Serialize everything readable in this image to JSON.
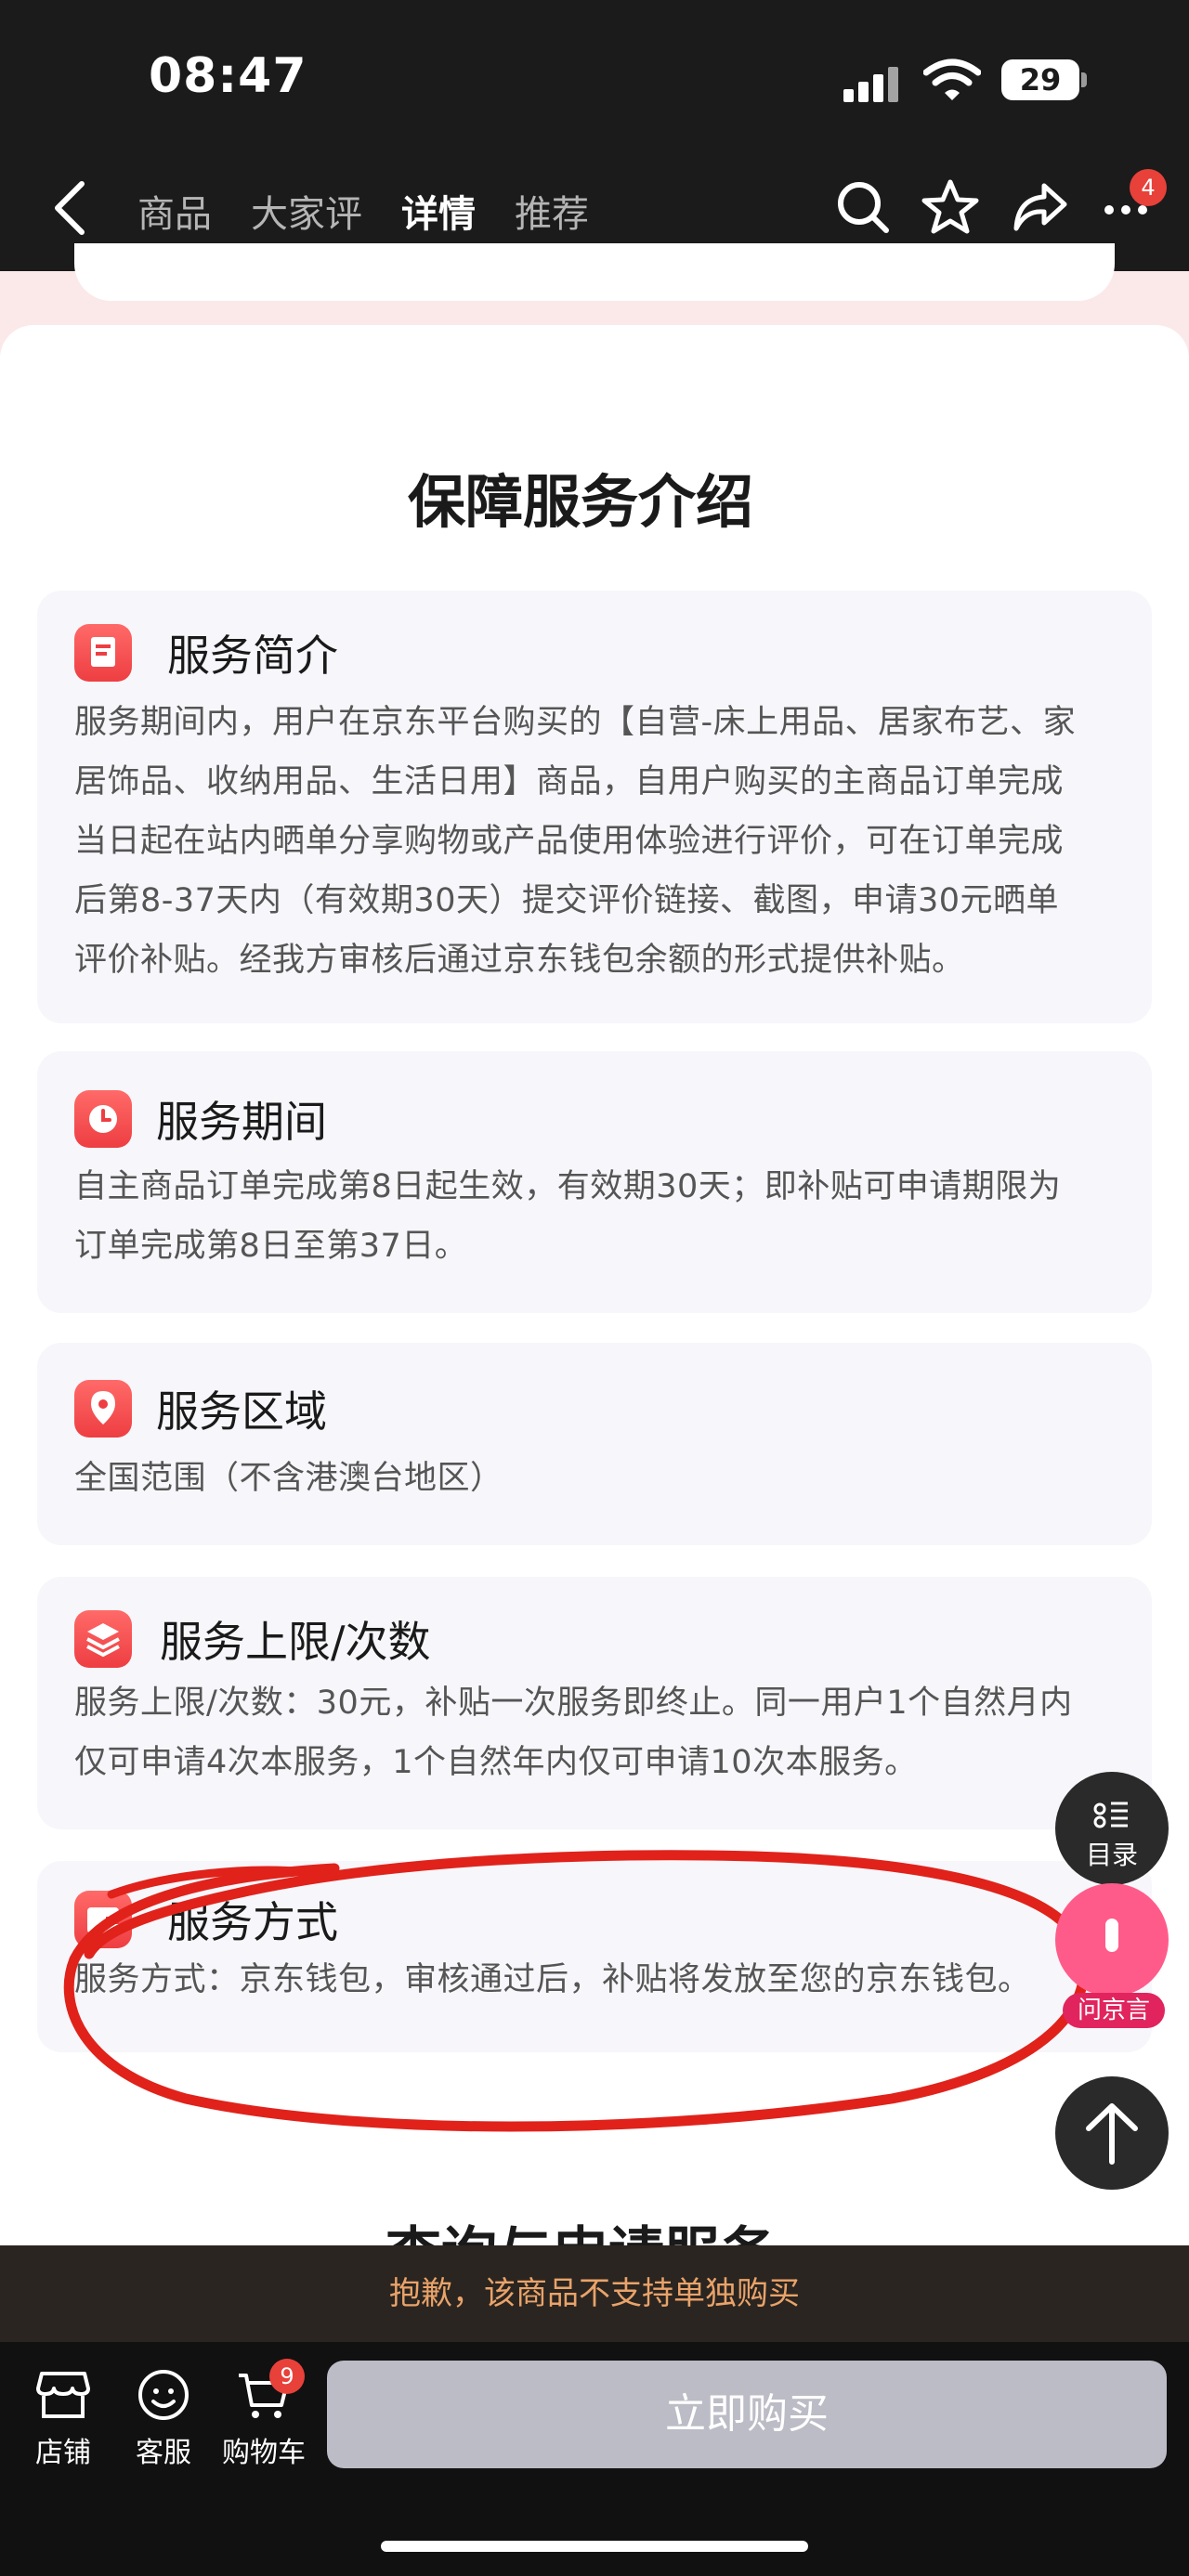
{
  "status_bar": {
    "time": "08:47",
    "battery": "29"
  },
  "nav": {
    "tabs": [
      {
        "label": "商品",
        "active": false
      },
      {
        "label": "大家评",
        "active": false
      },
      {
        "label": "详情",
        "active": true
      },
      {
        "label": "推荐",
        "active": false
      }
    ],
    "icons": [
      "back-icon",
      "search-icon",
      "star-icon",
      "share-icon",
      "more-icon"
    ],
    "more_badge": "4"
  },
  "panel": {
    "title": "保障服务介绍",
    "cards": [
      {
        "icon": "document-icon",
        "title": "服务简介",
        "lines": [
          "服务期间内，用户在京东平台购买的【自营-床上用品、居家布艺、家",
          "居饰品、收纳用品、生活日用】商品，自用户购买的主商品订单完成",
          "当日起在站内晒单分享购物或产品使用体验进行评价，可在订单完成",
          "后第8-37天内（有效期30天）提交评价链接、截图，申请30元晒单",
          "评价补贴。经我方审核后通过京东钱包余额的形式提供补贴。"
        ]
      },
      {
        "icon": "clock-icon",
        "title": "服务期间",
        "lines": [
          "自主商品订单完成第8日起生效，有效期30天；即补贴可申请期限为",
          "订单完成第8日至第37日。"
        ]
      },
      {
        "icon": "location-icon",
        "title": "服务区域",
        "lines": [
          "全国范围（不含港澳台地区）"
        ]
      },
      {
        "icon": "layers-icon",
        "title": "服务上限/次数",
        "lines": [
          "服务上限/次数：30元，补贴一次服务即终止。同一用户1个自然月内",
          "仅可申请4次本服务，1个自然年内仅可申请10次本服务。"
        ]
      },
      {
        "icon": "wallet-icon",
        "title": "服务方式",
        "lines": [
          "服务方式：京东钱包，审核通过后，补贴将发放至您的京东钱包。"
        ]
      }
    ],
    "next_section_title": "查询与申请服务"
  },
  "floating": {
    "toc_label": "目录",
    "assistant_label": "问京言"
  },
  "notice": "抱歉，该商品不支持单独购买",
  "bottom_bar": {
    "shop": "店铺",
    "service": "客服",
    "cart": "购物车",
    "cart_badge": "9",
    "buy": "立即购买"
  },
  "colors": {
    "accent": "#ee3e42",
    "annotation": "#e0221b",
    "notice_text": "#e9a36a"
  }
}
